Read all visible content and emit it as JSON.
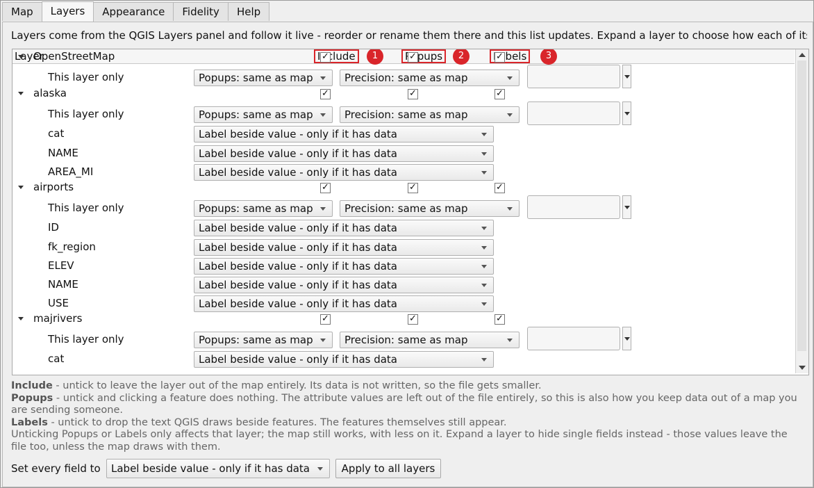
{
  "tabs": [
    {
      "label": "Map",
      "active": false
    },
    {
      "label": "Layers",
      "active": true
    },
    {
      "label": "Appearance",
      "active": false
    },
    {
      "label": "Fidelity",
      "active": false
    },
    {
      "label": "Help",
      "active": false
    }
  ],
  "intro": "Layers come from the QGIS Layers panel and follow it live - reorder or rename them there and this list updates. Expand a layer to choose how each of its",
  "tree": {
    "headers": {
      "layer": "Layer",
      "include": "Include",
      "popups": "Popups",
      "labels": "Labels",
      "badges": [
        "1",
        "2",
        "3"
      ]
    },
    "layers": [
      {
        "name": "OpenStreetMap",
        "include": true,
        "popups": true,
        "labels": true,
        "settings": {
          "label": "This layer only",
          "popups": "Popups: same as map",
          "precision": "Precision: same as map"
        },
        "fields": []
      },
      {
        "name": "alaska",
        "include": true,
        "popups": true,
        "labels": true,
        "settings": {
          "label": "This layer only",
          "popups": "Popups: same as map",
          "precision": "Precision: same as map"
        },
        "fields": [
          {
            "name": "cat",
            "mode": "Label beside value - only if it has data"
          },
          {
            "name": "NAME",
            "mode": "Label beside value - only if it has data"
          },
          {
            "name": "AREA_MI",
            "mode": "Label beside value - only if it has data"
          }
        ]
      },
      {
        "name": "airports",
        "include": true,
        "popups": true,
        "labels": true,
        "settings": {
          "label": "This layer only",
          "popups": "Popups: same as map",
          "precision": "Precision: same as map"
        },
        "fields": [
          {
            "name": "ID",
            "mode": "Label beside value - only if it has data"
          },
          {
            "name": "fk_region",
            "mode": "Label beside value - only if it has data"
          },
          {
            "name": "ELEV",
            "mode": "Label beside value - only if it has data"
          },
          {
            "name": "NAME",
            "mode": "Label beside value - only if it has data"
          },
          {
            "name": "USE",
            "mode": "Label beside value - only if it has data"
          }
        ]
      },
      {
        "name": "majrivers",
        "include": true,
        "popups": true,
        "labels": true,
        "settings": {
          "label": "This layer only",
          "popups": "Popups: same as map",
          "precision": "Precision: same as map"
        },
        "fields": [
          {
            "name": "cat",
            "mode": "Label beside value - only if it has data"
          }
        ]
      }
    ]
  },
  "help": {
    "include_term": "Include",
    "include_text": " - untick to leave the layer out of the map entirely. Its data is not written, so the file gets smaller.",
    "popups_term": "Popups",
    "popups_text": " - untick and clicking a feature does nothing. The attribute values are left out of the file entirely, so this is also how you keep data out of a map you are sending someone.",
    "labels_term": "Labels",
    "labels_text": " - untick to drop the text QGIS draws beside features. The features themselves still appear.",
    "note": "Unticking Popups or Labels only affects that layer; the map still works, with less on it. Expand a layer to hide single fields instead - those values leave the file too, unless the map draws with them."
  },
  "bottom": {
    "set_label": "Set every field to",
    "set_value": "Label beside value - only if it has data",
    "apply_label": "Apply to all layers"
  },
  "colors": {
    "annotation_red": "#d9252a"
  },
  "icons": [
    "caret-down-icon",
    "checkmark-icon",
    "chevron-down-icon",
    "scroll-up-icon",
    "scroll-down-icon"
  ]
}
